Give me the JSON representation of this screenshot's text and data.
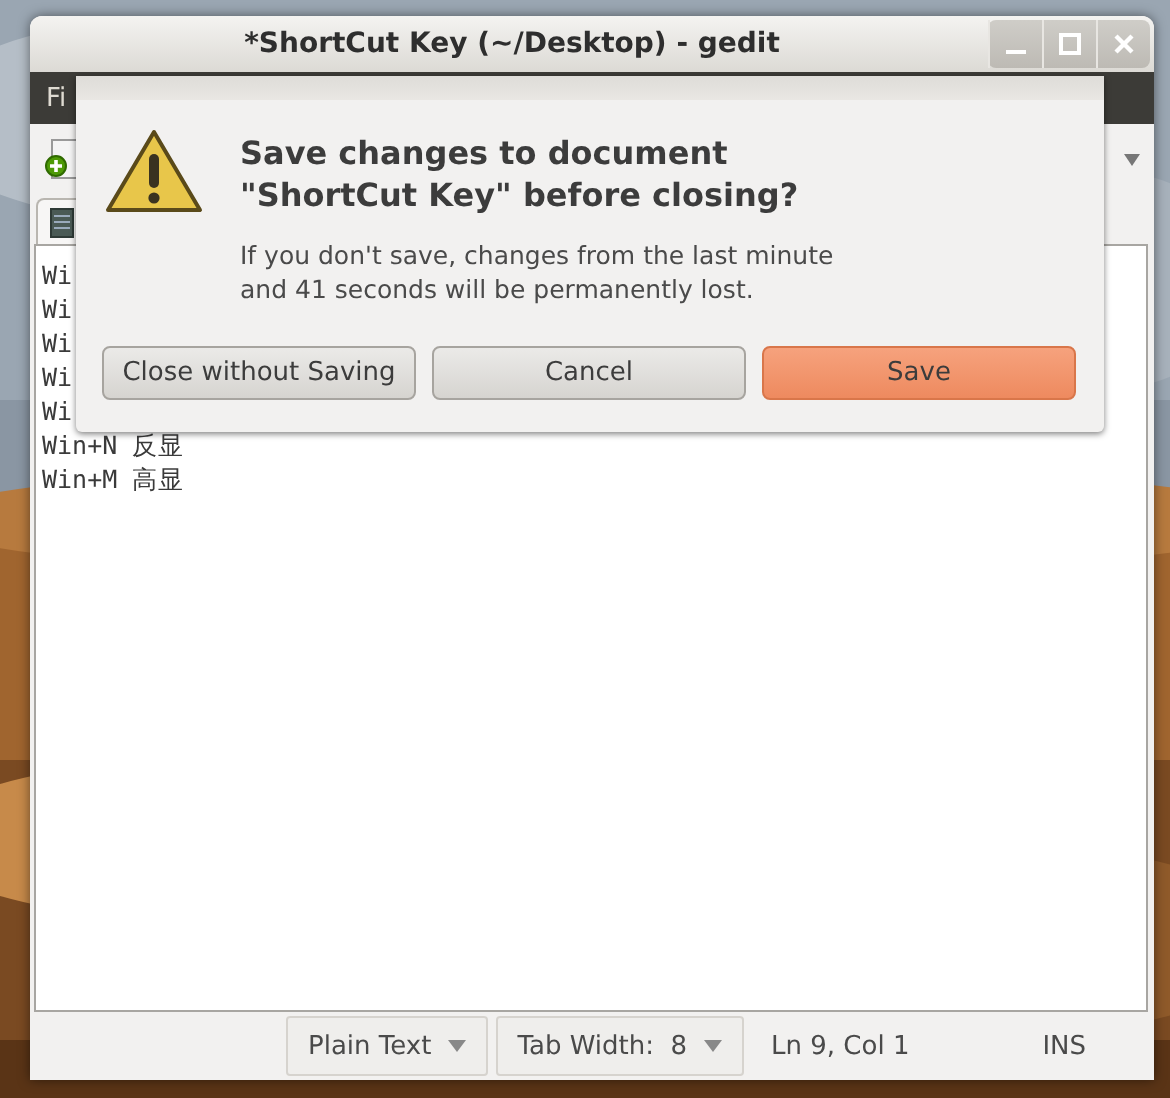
{
  "window": {
    "title": "*ShortCut Key (~/Desktop) - gedit"
  },
  "menu_bar": {
    "items": [
      "Fi"
    ]
  },
  "editor": {
    "lines": [
      "Wi",
      "Wi",
      "Wi",
      "Wi",
      "Wi",
      "Win+N 反显",
      "Win+M 高显"
    ]
  },
  "dialog": {
    "heading_lines": [
      "Save changes to document",
      "\"ShortCut Key\" before closing?"
    ],
    "message_lines": [
      "If you don't save, changes from the last minute",
      "and 41 seconds will be permanently lost."
    ],
    "buttons": [
      {
        "label": "Close without Saving",
        "kind": "normal"
      },
      {
        "label": "Cancel",
        "kind": "normal"
      },
      {
        "label": "Save",
        "kind": "default"
      }
    ]
  },
  "status_bar": {
    "items": [
      {
        "label": "Plain Text",
        "kind": "dropdown"
      },
      {
        "label": "Tab Width:  8",
        "kind": "dropdown"
      },
      {
        "label": "Ln 9, Col 1",
        "kind": "text"
      },
      {
        "label": "INS",
        "kind": "text"
      }
    ]
  }
}
